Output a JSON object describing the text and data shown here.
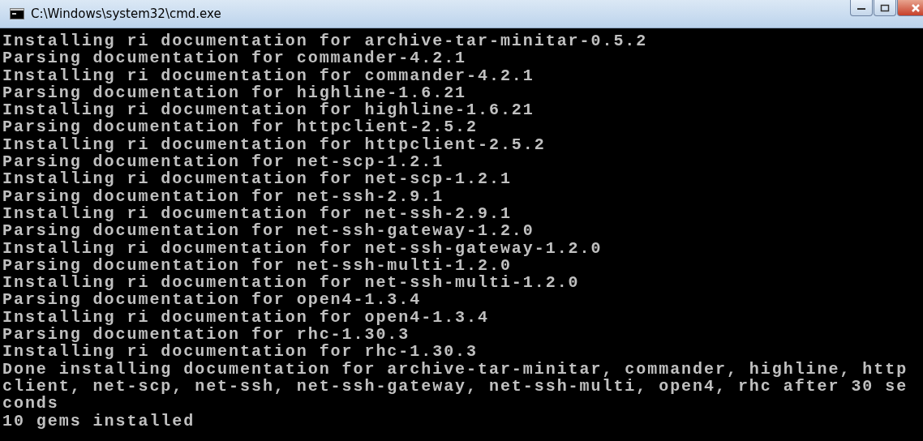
{
  "window": {
    "title": "C:\\Windows\\system32\\cmd.exe"
  },
  "console": {
    "lines": [
      "Installing ri documentation for archive-tar-minitar-0.5.2",
      "Parsing documentation for commander-4.2.1",
      "Installing ri documentation for commander-4.2.1",
      "Parsing documentation for highline-1.6.21",
      "Installing ri documentation for highline-1.6.21",
      "Parsing documentation for httpclient-2.5.2",
      "Installing ri documentation for httpclient-2.5.2",
      "Parsing documentation for net-scp-1.2.1",
      "Installing ri documentation for net-scp-1.2.1",
      "Parsing documentation for net-ssh-2.9.1",
      "Installing ri documentation for net-ssh-2.9.1",
      "Parsing documentation for net-ssh-gateway-1.2.0",
      "Installing ri documentation for net-ssh-gateway-1.2.0",
      "Parsing documentation for net-ssh-multi-1.2.0",
      "Installing ri documentation for net-ssh-multi-1.2.0",
      "Parsing documentation for open4-1.3.4",
      "Installing ri documentation for open4-1.3.4",
      "Parsing documentation for rhc-1.30.3",
      "Installing ri documentation for rhc-1.30.3",
      "Done installing documentation for archive-tar-minitar, commander, highline, http",
      "client, net-scp, net-ssh, net-ssh-gateway, net-ssh-multi, open4, rhc after 30 se",
      "conds",
      "10 gems installed"
    ]
  }
}
